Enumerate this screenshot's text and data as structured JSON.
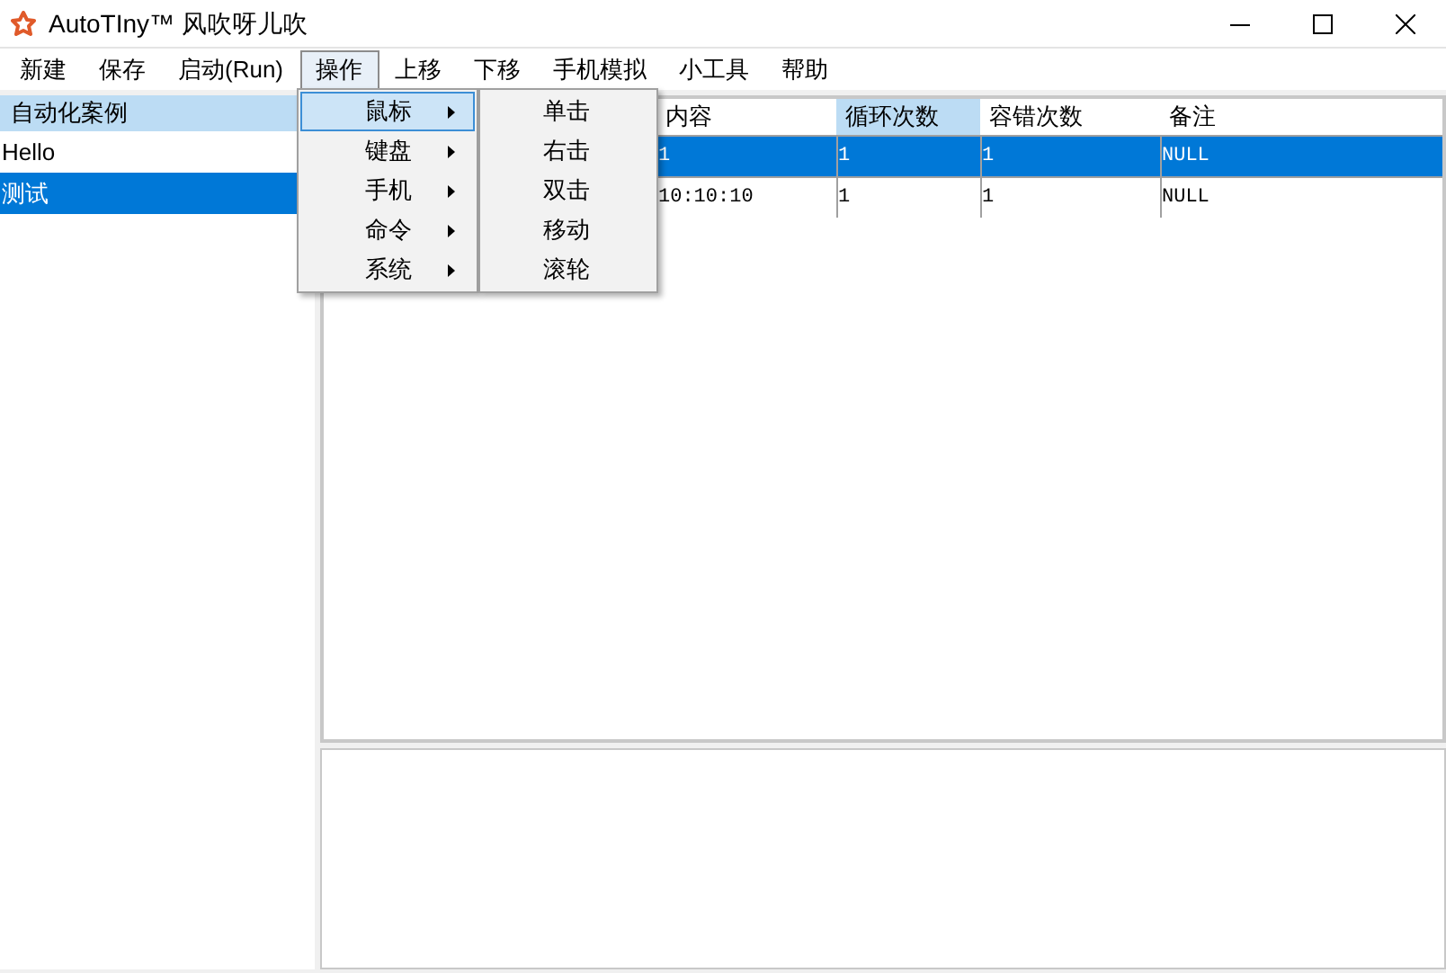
{
  "window": {
    "title": "AutoTIny™ 风吹呀儿吹"
  },
  "menu_bar": [
    {
      "label": "新建",
      "selected": false
    },
    {
      "label": "保存",
      "selected": false
    },
    {
      "label": "启动(Run)",
      "selected": false
    },
    {
      "label": "操作",
      "selected": true
    },
    {
      "label": "上移",
      "selected": false
    },
    {
      "label": "下移",
      "selected": false
    },
    {
      "label": "手机模拟",
      "selected": false
    },
    {
      "label": "小工具",
      "selected": false
    },
    {
      "label": "帮助",
      "selected": false
    }
  ],
  "dropdown": [
    {
      "label": "鼠标",
      "selected": true
    },
    {
      "label": "键盘",
      "selected": false
    },
    {
      "label": "手机",
      "selected": false
    },
    {
      "label": "命令",
      "selected": false
    },
    {
      "label": "系统",
      "selected": false
    }
  ],
  "submenu": [
    "单击",
    "右击",
    "双击",
    "移动",
    "滚轮"
  ],
  "case_list": {
    "header": "自动化案例",
    "items": [
      {
        "label": "Hello",
        "selected": false
      },
      {
        "label": "测试",
        "selected": true
      }
    ]
  },
  "table": {
    "columns": [
      {
        "label": "内容",
        "selected": false
      },
      {
        "label": "循环次数",
        "selected": true
      },
      {
        "label": "容错次数",
        "selected": false
      },
      {
        "label": "备注",
        "selected": false
      }
    ],
    "rows": [
      {
        "cells": [
          "1",
          "1",
          "1",
          "NULL"
        ],
        "selected": true
      },
      {
        "cells": [
          "10:10:10",
          "1",
          "1",
          "NULL"
        ],
        "selected": false
      }
    ]
  }
}
